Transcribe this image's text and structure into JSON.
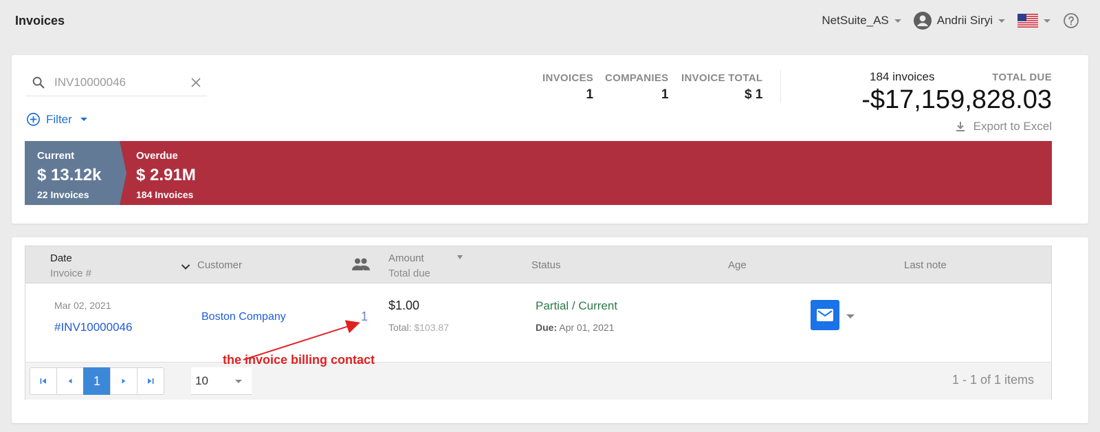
{
  "header": {
    "title": "Invoices",
    "account": "NetSuite_AS",
    "user": "Andrii Siryi"
  },
  "search": {
    "value": "INV10000046"
  },
  "filter": {
    "label": "Filter"
  },
  "stats": {
    "invoices_label": "INVOICES",
    "invoices_value": "1",
    "companies_label": "COMPANIES",
    "companies_value": "1",
    "invoice_total_label": "INVOICE TOTAL",
    "invoice_total_value": "$ 1"
  },
  "summary": {
    "count": "184 invoices",
    "total_due_label": "TOTAL DUE",
    "total_due_value": "-$17,159,828.03",
    "export_label": "Export to Excel"
  },
  "aging": {
    "current": {
      "label": "Current",
      "amount": "$ 13.12k",
      "count": "22 Invoices",
      "color": "#637a97"
    },
    "overdue": {
      "label": "Overdue",
      "amount": "$ 2.91M",
      "count": "184 Invoices",
      "color": "#b02f3f"
    }
  },
  "table": {
    "columns": {
      "date": "Date",
      "invoice_no": "Invoice #",
      "customer": "Customer",
      "amount": "Amount",
      "total_due": "Total due",
      "status": "Status",
      "age": "Age",
      "last_note": "Last note"
    },
    "rows": [
      {
        "date": "Mar 02, 2021",
        "invoice": "#INV10000046",
        "customer": "Boston Company",
        "contacts": "1",
        "amount": "$1.00",
        "total_label": "Total:",
        "total_value": "$103.87",
        "status": "Partial / Current",
        "due_label": "Due:",
        "due_value": "Apr 01, 2021"
      }
    ],
    "pager": {
      "current_page": "1",
      "page_size": "10",
      "items_info": "1 - 1 of 1 items"
    }
  },
  "annotation": {
    "text": "the invoice billing contact",
    "color": "#e02020"
  }
}
